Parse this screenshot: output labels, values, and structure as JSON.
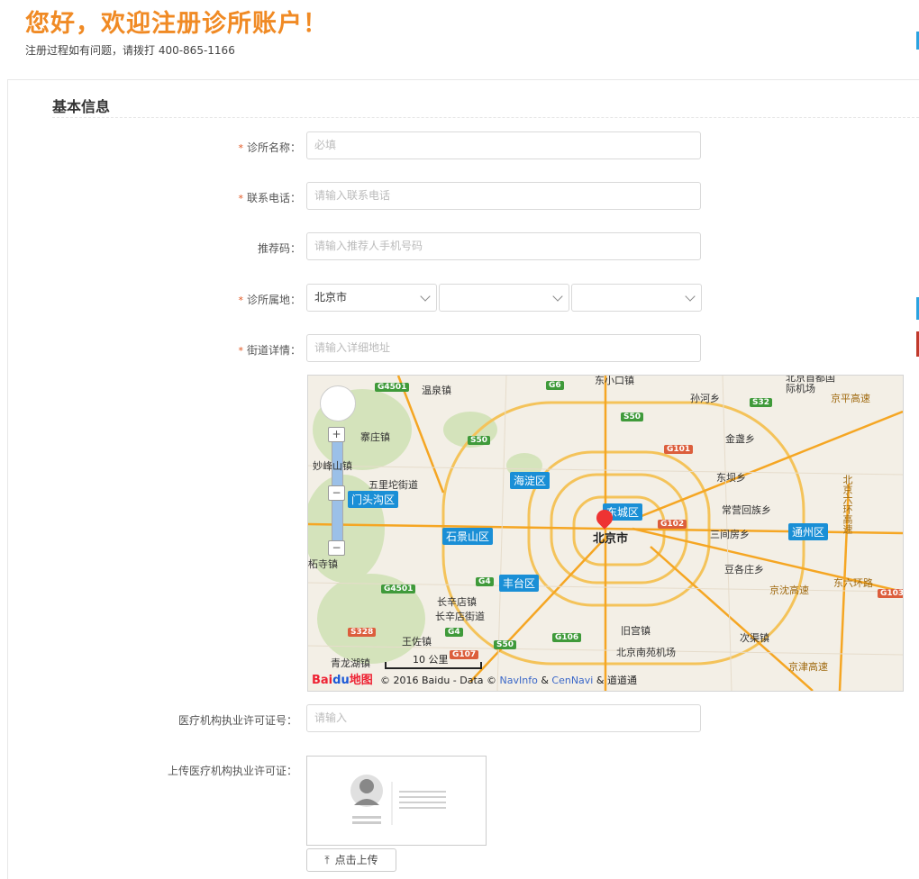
{
  "header": {
    "title": "您好，欢迎注册诊所账户！",
    "subtitle": "注册过程如有问题，请拨打 400-865-1166"
  },
  "section": {
    "title": "基本信息"
  },
  "form": {
    "clinic_name": {
      "label": "诊所名称：",
      "placeholder": "必填",
      "required": true
    },
    "phone": {
      "label": "联系电话：",
      "placeholder": "请输入联系电话",
      "required": true
    },
    "referral": {
      "label": "推荐码：",
      "placeholder": "请输入推荐人手机号码",
      "required": false
    },
    "region": {
      "label": "诊所属地：",
      "province": "北京市",
      "city": "",
      "district": "",
      "required": true
    },
    "street": {
      "label": "街道详情：",
      "placeholder": "请输入详细地址",
      "required": true
    },
    "license_no": {
      "label": "医疗机构执业许可证号：",
      "placeholder": "请输入"
    },
    "license_upload": {
      "label": "上传医疗机构执业许可证：",
      "button": "点击上传"
    }
  },
  "required_mark": "*",
  "map": {
    "city_label": "北京市",
    "districts": [
      "海淀区",
      "东城区",
      "门头沟区",
      "石景山区",
      "丰台区",
      "通州区"
    ],
    "places": [
      "温泉镇",
      "东小口镇",
      "北京首都国际机场",
      "孙河乡",
      "寨庄镇",
      "金盏乡",
      "妙峰山镇",
      "东坝乡",
      "五里坨街道",
      "常营回族乡",
      "三间房乡",
      "柘寺镇",
      "豆各庄乡",
      "长辛店镇",
      "长辛店街道",
      "旧宫镇",
      "王佐镇",
      "北京南苑机场",
      "次渠镇",
      "青龙湖镇",
      "京平高速",
      "北京六环高速",
      "京沈高速",
      "东六环路",
      "京津高速"
    ],
    "roads": [
      "G4501",
      "G6",
      "S50",
      "S32",
      "G101",
      "G102",
      "G4",
      "S328",
      "G107",
      "G106",
      "G103"
    ],
    "scale_label": "10 公里",
    "logo_text": "Bai",
    "logo_paw": "du",
    "logo_suffix": "地图",
    "copyright_prefix": "© 2016 Baidu - Data ©",
    "copyright_link1": "NavInfo",
    "copyright_mid": "&",
    "copyright_link2": "CenNavi",
    "copyright_suffix": "& 道道通",
    "zoom_in": "+",
    "zoom_out": "−"
  },
  "colors": {
    "accent": "#f08a24",
    "required": "#e2551f",
    "district": "#1a8fd6"
  }
}
